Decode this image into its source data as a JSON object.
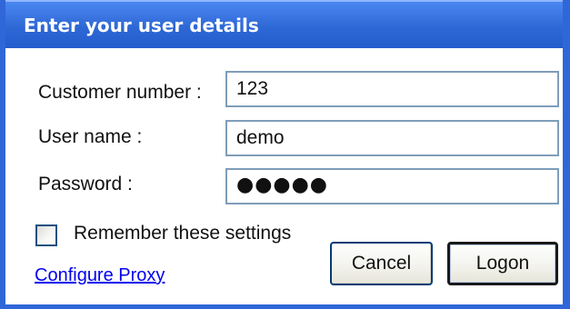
{
  "dialog": {
    "title": "Enter your user details",
    "accent_color": "#2f67d8"
  },
  "form": {
    "customer_number": {
      "label": "Customer number :",
      "value": "123"
    },
    "user_name": {
      "label": "User name :",
      "value": "demo"
    },
    "password": {
      "label": "Password :",
      "value": "●●●●●"
    },
    "remember": {
      "label": "Remember these settings",
      "checked": false
    }
  },
  "links": {
    "configure_proxy": "Configure Proxy"
  },
  "buttons": {
    "cancel": "Cancel",
    "logon": "Logon"
  }
}
